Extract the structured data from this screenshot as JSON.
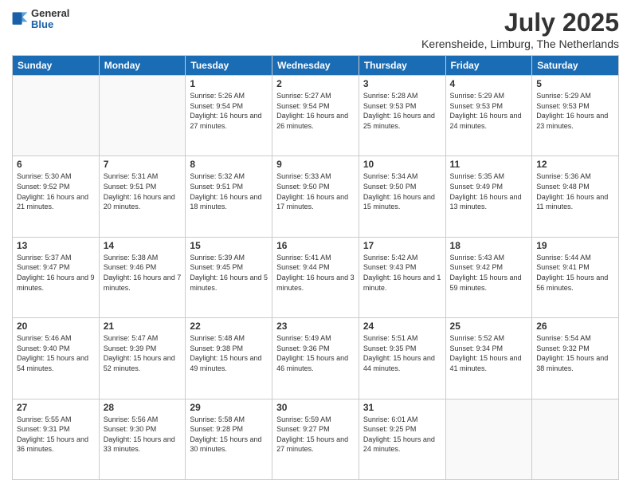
{
  "header": {
    "logo_general": "General",
    "logo_blue": "Blue",
    "main_title": "July 2025",
    "subtitle": "Kerensheide, Limburg, The Netherlands"
  },
  "calendar": {
    "days_of_week": [
      "Sunday",
      "Monday",
      "Tuesday",
      "Wednesday",
      "Thursday",
      "Friday",
      "Saturday"
    ],
    "weeks": [
      [
        {
          "day": "",
          "info": ""
        },
        {
          "day": "",
          "info": ""
        },
        {
          "day": "1",
          "info": "Sunrise: 5:26 AM\nSunset: 9:54 PM\nDaylight: 16 hours and 27 minutes."
        },
        {
          "day": "2",
          "info": "Sunrise: 5:27 AM\nSunset: 9:54 PM\nDaylight: 16 hours and 26 minutes."
        },
        {
          "day": "3",
          "info": "Sunrise: 5:28 AM\nSunset: 9:53 PM\nDaylight: 16 hours and 25 minutes."
        },
        {
          "day": "4",
          "info": "Sunrise: 5:29 AM\nSunset: 9:53 PM\nDaylight: 16 hours and 24 minutes."
        },
        {
          "day": "5",
          "info": "Sunrise: 5:29 AM\nSunset: 9:53 PM\nDaylight: 16 hours and 23 minutes."
        }
      ],
      [
        {
          "day": "6",
          "info": "Sunrise: 5:30 AM\nSunset: 9:52 PM\nDaylight: 16 hours and 21 minutes."
        },
        {
          "day": "7",
          "info": "Sunrise: 5:31 AM\nSunset: 9:51 PM\nDaylight: 16 hours and 20 minutes."
        },
        {
          "day": "8",
          "info": "Sunrise: 5:32 AM\nSunset: 9:51 PM\nDaylight: 16 hours and 18 minutes."
        },
        {
          "day": "9",
          "info": "Sunrise: 5:33 AM\nSunset: 9:50 PM\nDaylight: 16 hours and 17 minutes."
        },
        {
          "day": "10",
          "info": "Sunrise: 5:34 AM\nSunset: 9:50 PM\nDaylight: 16 hours and 15 minutes."
        },
        {
          "day": "11",
          "info": "Sunrise: 5:35 AM\nSunset: 9:49 PM\nDaylight: 16 hours and 13 minutes."
        },
        {
          "day": "12",
          "info": "Sunrise: 5:36 AM\nSunset: 9:48 PM\nDaylight: 16 hours and 11 minutes."
        }
      ],
      [
        {
          "day": "13",
          "info": "Sunrise: 5:37 AM\nSunset: 9:47 PM\nDaylight: 16 hours and 9 minutes."
        },
        {
          "day": "14",
          "info": "Sunrise: 5:38 AM\nSunset: 9:46 PM\nDaylight: 16 hours and 7 minutes."
        },
        {
          "day": "15",
          "info": "Sunrise: 5:39 AM\nSunset: 9:45 PM\nDaylight: 16 hours and 5 minutes."
        },
        {
          "day": "16",
          "info": "Sunrise: 5:41 AM\nSunset: 9:44 PM\nDaylight: 16 hours and 3 minutes."
        },
        {
          "day": "17",
          "info": "Sunrise: 5:42 AM\nSunset: 9:43 PM\nDaylight: 16 hours and 1 minute."
        },
        {
          "day": "18",
          "info": "Sunrise: 5:43 AM\nSunset: 9:42 PM\nDaylight: 15 hours and 59 minutes."
        },
        {
          "day": "19",
          "info": "Sunrise: 5:44 AM\nSunset: 9:41 PM\nDaylight: 15 hours and 56 minutes."
        }
      ],
      [
        {
          "day": "20",
          "info": "Sunrise: 5:46 AM\nSunset: 9:40 PM\nDaylight: 15 hours and 54 minutes."
        },
        {
          "day": "21",
          "info": "Sunrise: 5:47 AM\nSunset: 9:39 PM\nDaylight: 15 hours and 52 minutes."
        },
        {
          "day": "22",
          "info": "Sunrise: 5:48 AM\nSunset: 9:38 PM\nDaylight: 15 hours and 49 minutes."
        },
        {
          "day": "23",
          "info": "Sunrise: 5:49 AM\nSunset: 9:36 PM\nDaylight: 15 hours and 46 minutes."
        },
        {
          "day": "24",
          "info": "Sunrise: 5:51 AM\nSunset: 9:35 PM\nDaylight: 15 hours and 44 minutes."
        },
        {
          "day": "25",
          "info": "Sunrise: 5:52 AM\nSunset: 9:34 PM\nDaylight: 15 hours and 41 minutes."
        },
        {
          "day": "26",
          "info": "Sunrise: 5:54 AM\nSunset: 9:32 PM\nDaylight: 15 hours and 38 minutes."
        }
      ],
      [
        {
          "day": "27",
          "info": "Sunrise: 5:55 AM\nSunset: 9:31 PM\nDaylight: 15 hours and 36 minutes."
        },
        {
          "day": "28",
          "info": "Sunrise: 5:56 AM\nSunset: 9:30 PM\nDaylight: 15 hours and 33 minutes."
        },
        {
          "day": "29",
          "info": "Sunrise: 5:58 AM\nSunset: 9:28 PM\nDaylight: 15 hours and 30 minutes."
        },
        {
          "day": "30",
          "info": "Sunrise: 5:59 AM\nSunset: 9:27 PM\nDaylight: 15 hours and 27 minutes."
        },
        {
          "day": "31",
          "info": "Sunrise: 6:01 AM\nSunset: 9:25 PM\nDaylight: 15 hours and 24 minutes."
        },
        {
          "day": "",
          "info": ""
        },
        {
          "day": "",
          "info": ""
        }
      ]
    ]
  }
}
